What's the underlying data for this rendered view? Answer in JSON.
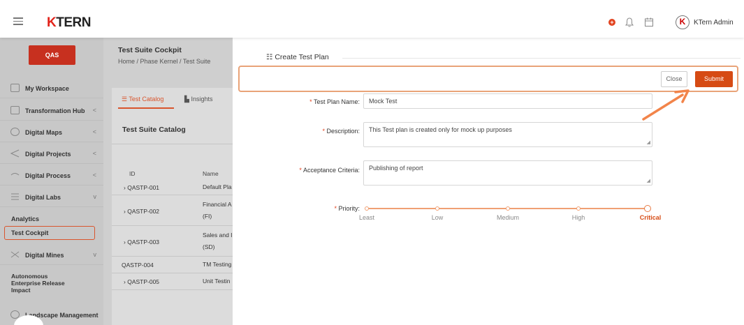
{
  "topbar": {
    "logo": "KTERN",
    "logo_k": "K",
    "logo_rest": "TERN",
    "user_initial": "K",
    "user_name": "KTern Admin"
  },
  "sidebar": {
    "project_button": "QAS",
    "items": [
      {
        "label": "My Workspace",
        "icon": "workspace-icon",
        "chevron": ""
      },
      {
        "label": "Transformation Hub",
        "icon": "grid-icon",
        "chevron": "<"
      },
      {
        "label": "Digital Maps",
        "icon": "map-icon",
        "chevron": "<"
      },
      {
        "label": "Digital Projects",
        "icon": "send-icon",
        "chevron": "<"
      },
      {
        "label": "Digital Process",
        "icon": "process-icon",
        "chevron": "<"
      },
      {
        "label": "Digital Labs",
        "icon": "labs-icon",
        "chevron": "v"
      },
      {
        "label": "Digital Mines",
        "icon": "mines-icon",
        "chevron": "v"
      },
      {
        "label": "Landscape Management",
        "icon": "landscape-icon",
        "chevron": ""
      }
    ],
    "labs_sub": [
      "Analytics",
      "Test Cockpit"
    ],
    "mines_sub": "Autonomous Enterprise Release Impact",
    "mines_sub_lines": [
      "Autonomous",
      "Enterprise Release",
      "Impact"
    ],
    "landscape_partial": "~ndscape Management"
  },
  "main": {
    "title": "Test Suite Cockpit",
    "breadcrumb": "Home  /  Phase Kernel  /  Test Suite",
    "tabs": [
      {
        "label": "Test Catalog",
        "active": true
      },
      {
        "label": "Insights",
        "active": false
      }
    ],
    "catalog_title": "Test Suite Catalog",
    "columns": [
      "ID",
      "Name"
    ],
    "rows": [
      {
        "id": "QASTP-001",
        "name": "Default Pla",
        "name2": "",
        "expandable": true
      },
      {
        "id": "QASTP-002",
        "name": "Financial A",
        "name2": "(FI)",
        "expandable": true
      },
      {
        "id": "QASTP-003",
        "name": "Sales and I",
        "name2": "(SD)",
        "expandable": true
      },
      {
        "id": "QASTP-004",
        "name": "TM Testing",
        "name2": "",
        "expandable": false
      },
      {
        "id": "QASTP-005",
        "name": "Unit Testin",
        "name2": "",
        "expandable": true
      }
    ]
  },
  "panel": {
    "title": "Create Test Plan",
    "close_label": "Close",
    "submit_label": "Submit",
    "fields": {
      "name": {
        "label": "Test Plan Name:",
        "value": "Mock Test"
      },
      "description": {
        "label": "Description:",
        "value": "This Test plan is created only for mock up purposes"
      },
      "acceptance": {
        "label": "Acceptance Criteria:",
        "value": "Publishing of report"
      },
      "priority": {
        "label": "Priority:",
        "value": "Critical"
      }
    },
    "priority_levels": [
      "Least",
      "Low",
      "Medium",
      "High",
      "Critical"
    ],
    "priority_selected_index": 4
  },
  "colors": {
    "accent": "#d64b14",
    "qas": "#c7301f",
    "highlight": "#e9a378"
  }
}
